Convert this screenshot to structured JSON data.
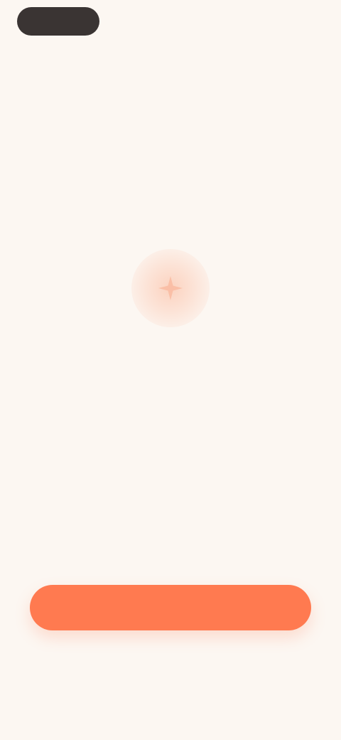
{
  "header": {
    "brand_label": "",
    "top_link_label": "",
    "sub_hint": ""
  },
  "hero": {
    "icon": "sparkle-icon",
    "title": "",
    "subtitle": ""
  },
  "actions": {
    "primary_label": ""
  },
  "footer": {
    "note_text": "",
    "note_link": ""
  },
  "colors": {
    "background": "#FCF7F2",
    "accent": "#FF7A50",
    "brand_pill": "#3A3433",
    "title_text": "#4B4241"
  }
}
